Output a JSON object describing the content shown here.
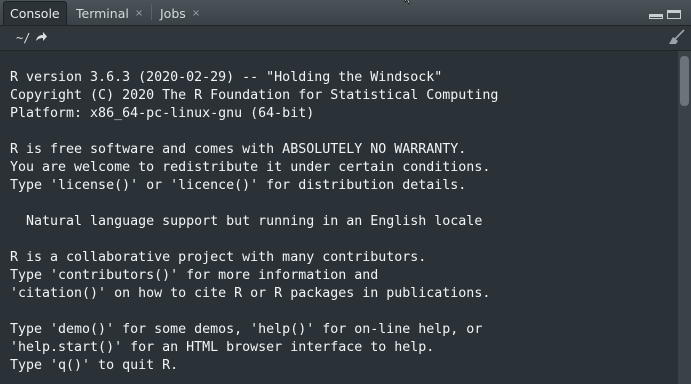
{
  "tabs": [
    {
      "label": "Console",
      "active": true
    },
    {
      "label": "Terminal",
      "close": "×"
    },
    {
      "label": "Jobs",
      "close": "×"
    }
  ],
  "toolbar": {
    "path": "~/",
    "go_icon": "arrow-forward-icon",
    "clear_icon": "broom-icon"
  },
  "window_controls": [
    "minimize-icon",
    "maximize-icon"
  ],
  "console": {
    "lines": [
      "R version 3.6.3 (2020-02-29) -- \"Holding the Windsock\"",
      "Copyright (C) 2020 The R Foundation for Statistical Computing",
      "Platform: x86_64-pc-linux-gnu (64-bit)",
      "",
      "R is free software and comes with ABSOLUTELY NO WARRANTY.",
      "You are welcome to redistribute it under certain conditions.",
      "Type 'license()' or 'licence()' for distribution details.",
      "",
      "  Natural language support but running in an English locale",
      "",
      "R is a collaborative project with many contributors.",
      "Type 'contributors()' for more information and",
      "'citation()' on how to cite R or R packages in publications.",
      "",
      "Type 'demo()' for some demos, 'help()' for on-line help, or",
      "'help.start()' for an HTML browser interface to help.",
      "Type 'q()' to quit R."
    ]
  },
  "colors": {
    "background": "#2a3238",
    "text": "#f2f4f5",
    "tabbar": "#3a4248"
  }
}
